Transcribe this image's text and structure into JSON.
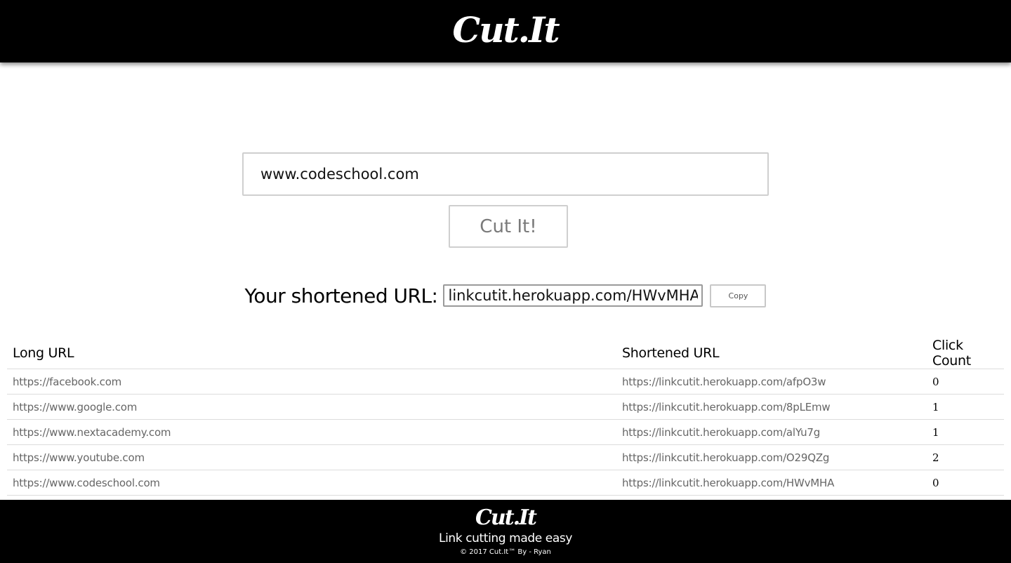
{
  "header": {
    "logo": "Cut.It"
  },
  "form": {
    "url_value": "www.codeschool.com",
    "submit_label": "Cut It!"
  },
  "result": {
    "label": "Your shortened URL:",
    "short_url": "linkcutit.herokuapp.com/HWvMHA",
    "copy_label": "Copy"
  },
  "table": {
    "headers": [
      "Long URL",
      "Shortened URL",
      "Click Count"
    ],
    "rows": [
      {
        "long": "https://facebook.com",
        "short": "https://linkcutit.herokuapp.com/afpO3w",
        "count": "0"
      },
      {
        "long": "https://www.google.com",
        "short": "https://linkcutit.herokuapp.com/8pLEmw",
        "count": "1"
      },
      {
        "long": "https://www.nextacademy.com",
        "short": "https://linkcutit.herokuapp.com/alYu7g",
        "count": "1"
      },
      {
        "long": "https://www.youtube.com",
        "short": "https://linkcutit.herokuapp.com/O29QZg",
        "count": "2"
      },
      {
        "long": "https://www.codeschool.com",
        "short": "https://linkcutit.herokuapp.com/HWvMHA",
        "count": "0"
      }
    ]
  },
  "footer": {
    "logo": "Cut.It",
    "tagline": "Link cutting made easy",
    "copyright": "© 2017 Cut.It™  By -  Ryan"
  }
}
